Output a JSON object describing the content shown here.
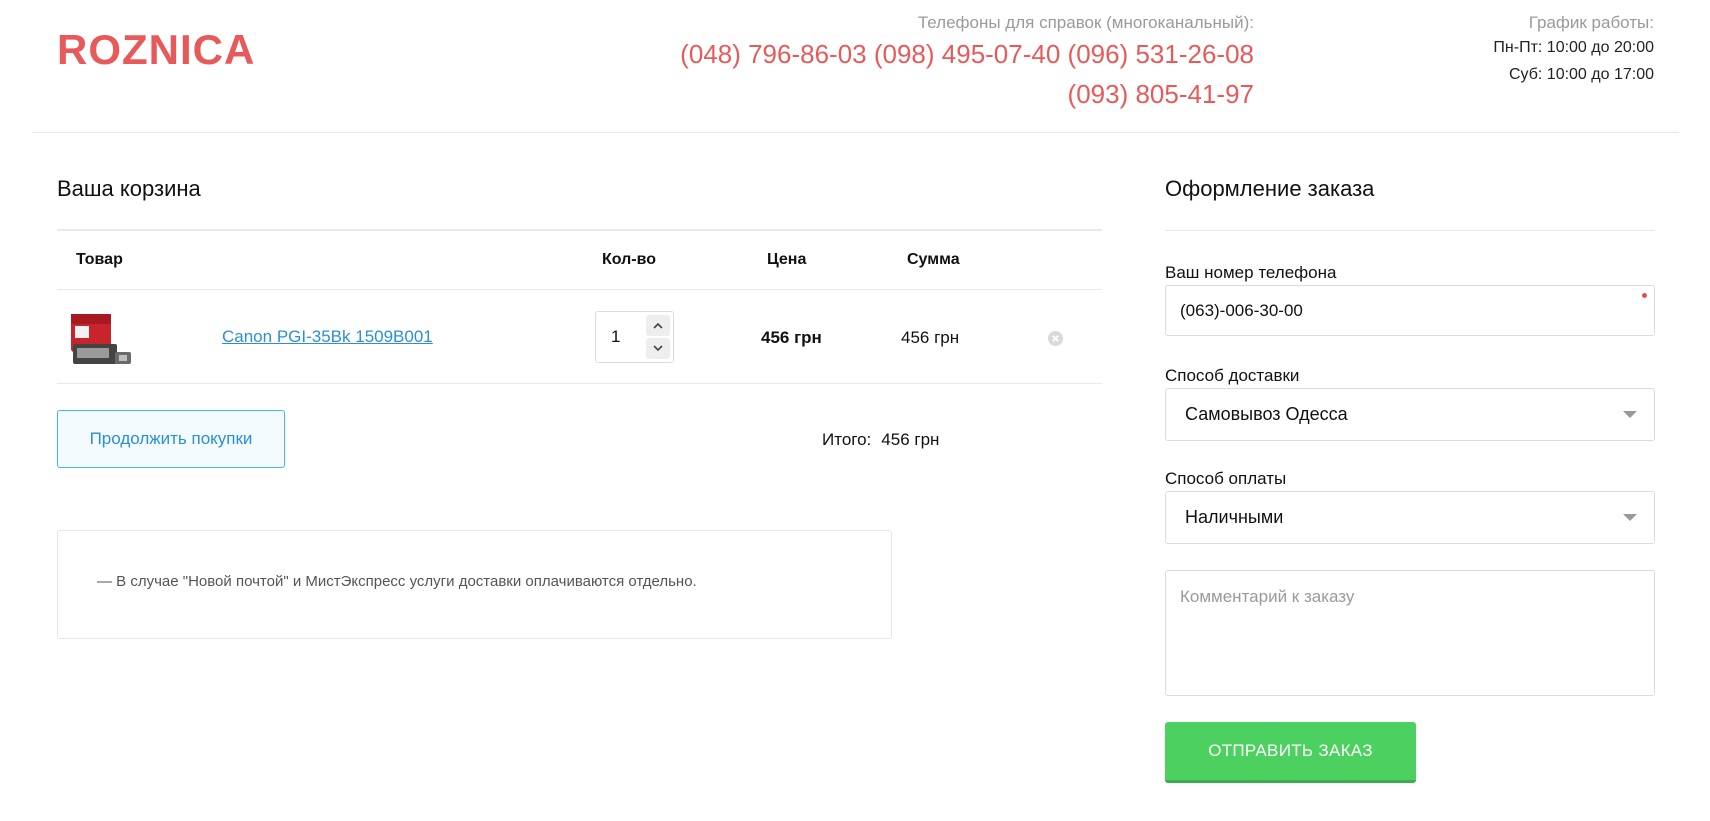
{
  "header": {
    "logo": "ROZNICA",
    "phones_caption": "Телефоны для справок (многоканальный):",
    "phones_line1": "(048) 796-86-03 (098) 495-07-40 (096) 531-26-08",
    "phones_line2": "(093) 805-41-97",
    "schedule_caption": "График работы:",
    "schedule_weekdays": "Пн-Пт: 10:00 до 20:00",
    "schedule_saturday": "Суб: 10:00 до 17:00"
  },
  "cart": {
    "title": "Ваша корзина",
    "columns": {
      "product": "Товар",
      "qty": "Кол-во",
      "price": "Цена",
      "sum": "Сумма"
    },
    "items": [
      {
        "name": "Canon PGI-35Bk 1509B001",
        "qty": "1",
        "price": "456 грн",
        "sum": "456 грн"
      }
    ],
    "continue_label": "Продолжить покупки",
    "total_label": "Итого:",
    "total_value": "456 грн",
    "notice": "— В случае \"Новой почтой\" и МистЭкспресс услуги доставки оплачиваются отдельно."
  },
  "order": {
    "title": "Оформление заказа",
    "phone_label": "Ваш номер телефона",
    "phone_value": "(063)-006-30-00",
    "delivery_label": "Способ доставки",
    "delivery_value": "Самовывоз Одесса",
    "payment_label": "Способ оплаты",
    "payment_value": "Наличными",
    "comment_placeholder": "Комментарий к заказу",
    "submit_label": "ОТПРАВИТЬ ЗАКАЗ"
  },
  "colors": {
    "brand": "#e85a5a",
    "link": "#2a8fd6",
    "submit": "#4cd05f",
    "continue_border": "#3fbce0"
  },
  "icons": [
    "chevron-up-icon",
    "chevron-down-icon",
    "remove-icon",
    "select-arrow-icon",
    "required-dot-icon"
  ]
}
